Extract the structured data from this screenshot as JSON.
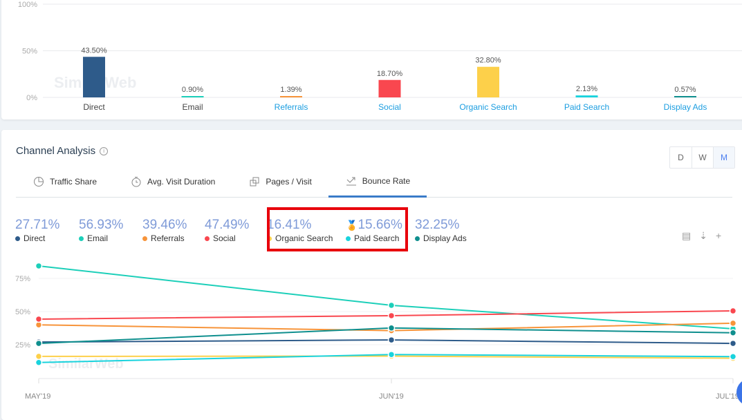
{
  "traffic_chart": {
    "type": "bar",
    "yticks": [
      "100%",
      "50%",
      "0%"
    ],
    "ylim": [
      0,
      100
    ],
    "categories": [
      {
        "label": "Direct",
        "value": 43.5,
        "value_label": "43.50%",
        "color": "#2e5b8a",
        "link": false
      },
      {
        "label": "Email",
        "value": 0.9,
        "value_label": "0.90%",
        "color": "#1ccfb9",
        "link": false
      },
      {
        "label": "Referrals",
        "value": 1.39,
        "value_label": "1.39%",
        "color": "#f7943a",
        "link": true
      },
      {
        "label": "Social",
        "value": 18.7,
        "value_label": "18.70%",
        "color": "#f9474f",
        "link": true
      },
      {
        "label": "Organic Search",
        "value": 32.8,
        "value_label": "32.80%",
        "color": "#fdd04a",
        "link": true
      },
      {
        "label": "Paid Search",
        "value": 2.13,
        "value_label": "2.13%",
        "color": "#19d3dd",
        "link": true
      },
      {
        "label": "Display Ads",
        "value": 0.57,
        "value_label": "0.57%",
        "color": "#0f8f8e",
        "link": true
      }
    ],
    "watermark": "SimilarWeb"
  },
  "channel": {
    "title": "Channel Analysis",
    "info_icon": "info-icon",
    "periods": [
      "D",
      "W",
      "M"
    ],
    "selected_period": "M",
    "tabs": [
      {
        "label": "Traffic Share",
        "icon": "pie-chart-icon"
      },
      {
        "label": "Avg. Visit Duration",
        "icon": "stopwatch-icon"
      },
      {
        "label": "Pages / Visit",
        "icon": "pages-icon"
      },
      {
        "label": "Bounce Rate",
        "icon": "bounce-icon",
        "active": true
      }
    ],
    "tools": [
      "export-excel-icon",
      "sort-icon",
      "add-icon"
    ]
  },
  "chart_data": {
    "type": "line",
    "title": "Bounce Rate",
    "x": [
      "MAY'19",
      "JUN'19",
      "JUL'19"
    ],
    "yticks": [
      "75%",
      "50%",
      "25%"
    ],
    "ylim": [
      0,
      90
    ],
    "series": [
      {
        "name": "Direct",
        "avg": "27.71%",
        "color": "#2e5b8a",
        "values": [
          27,
          28.6,
          26
        ]
      },
      {
        "name": "Email",
        "avg": "56.93%",
        "color": "#1ccfb9",
        "values": [
          84.4,
          54.7,
          37
        ]
      },
      {
        "name": "Referrals",
        "avg": "39.46%",
        "color": "#f7943a",
        "values": [
          40,
          35.6,
          41.2
        ]
      },
      {
        "name": "Social",
        "avg": "47.49%",
        "color": "#f9474f",
        "values": [
          44.3,
          46.9,
          50.5
        ]
      },
      {
        "name": "Organic Search",
        "avg": "16.41%",
        "color": "#fdd04a",
        "values": [
          16.2,
          16.4,
          14.8
        ]
      },
      {
        "name": "Paid Search",
        "avg": "15.66%",
        "color": "#19d3dd",
        "values": [
          11.6,
          17.6,
          16
        ]
      },
      {
        "name": "Display Ads",
        "avg": "32.25%",
        "color": "#0f8f8e",
        "values": [
          26,
          37.6,
          34
        ]
      }
    ],
    "winner_icon": "medal-icon",
    "watermark": "SimilarWeb"
  }
}
